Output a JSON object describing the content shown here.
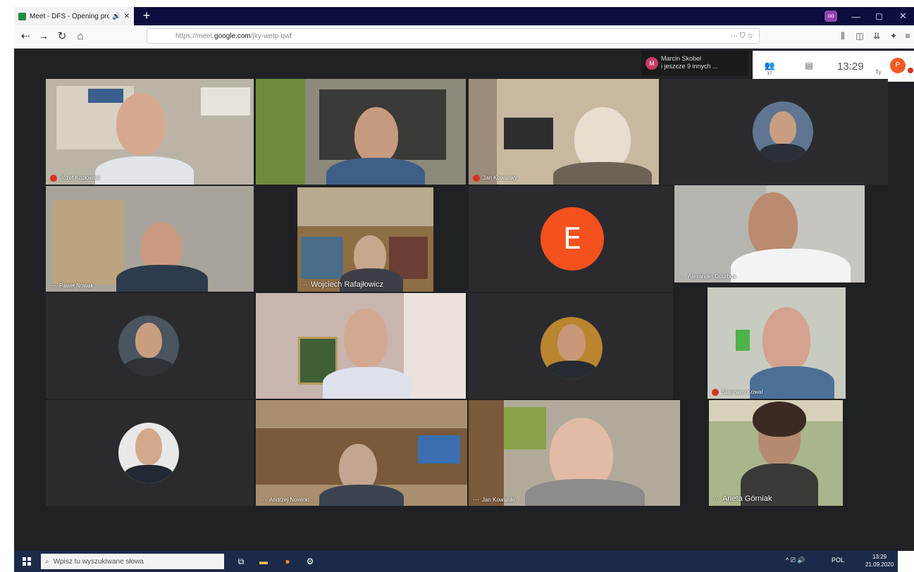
{
  "browser": {
    "tab_title": "Meet - DFS - Opening pro",
    "tab_audio_icon": "🔊",
    "tab_close": "✕",
    "new_tab": "+",
    "url_pre": "https://meet.",
    "url_domain": "google.com",
    "url_path": "/jky-wetp-qwf",
    "url_more": "··· ⛉ ☆",
    "window_controls": [
      "—",
      "◻",
      "✕"
    ]
  },
  "meet": {
    "participants_chip_initial": "M",
    "participants_chip_line1": "Marcin Skobel",
    "participants_chip_line2": "i jeszcze 9 innych ...",
    "people_count": "17",
    "time": "13:29",
    "you_label": "Ty",
    "self_initial": "P",
    "big_avatar_letter": "E"
  },
  "tiles": {
    "t1": "Józef Kozłowski",
    "t3": "Jan Kowalsky",
    "t5": "Paweł Nowak",
    "t6": "Wojciech Rafajłowicz",
    "t8": "Alexander Dourbos",
    "t11": "Stanisław Kowal",
    "t14": "Andrzej Nowicki",
    "t15": "Jan Kowalski",
    "t16": "Aneta Górniak"
  },
  "taskbar": {
    "search_placeholder": "Wpisz tu wyszukiwane słowa",
    "tray": "^ ⎚ 🔊",
    "lang": "POL",
    "clock_time": "13:29",
    "clock_date": "21.09.2020"
  }
}
